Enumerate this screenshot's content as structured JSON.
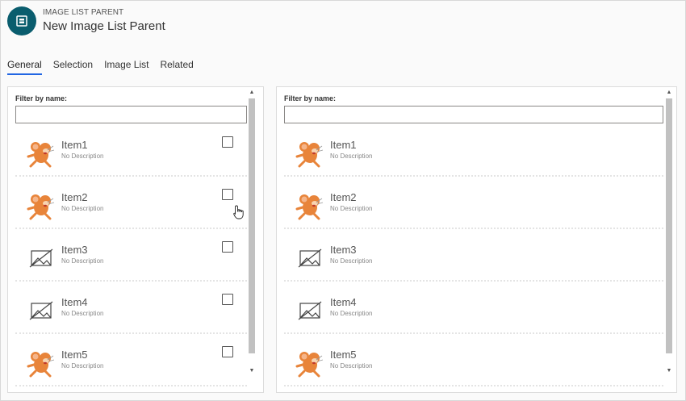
{
  "header": {
    "entity_type": "IMAGE LIST PARENT",
    "record_title": "New Image List Parent",
    "icon": "entity-icon"
  },
  "tabs": [
    {
      "label": "General",
      "active": true
    },
    {
      "label": "Selection",
      "active": false
    },
    {
      "label": "Image List",
      "active": false
    },
    {
      "label": "Related",
      "active": false
    }
  ],
  "left_panel": {
    "filter_label": "Filter by name:",
    "filter_value": "",
    "items": [
      {
        "name": "Item1",
        "description": "No Description",
        "image": "cartoon-mouse",
        "checked": false
      },
      {
        "name": "Item2",
        "description": "No Description",
        "image": "cartoon-mouse",
        "checked": false
      },
      {
        "name": "Item3",
        "description": "No Description",
        "image": "image-placeholder",
        "checked": false
      },
      {
        "name": "Item4",
        "description": "No Description",
        "image": "image-placeholder",
        "checked": false
      },
      {
        "name": "Item5",
        "description": "No Description",
        "image": "cartoon-mouse",
        "checked": false
      }
    ]
  },
  "right_panel": {
    "filter_label": "Filter by name:",
    "filter_value": "",
    "items": [
      {
        "name": "Item1",
        "description": "No Description",
        "image": "cartoon-mouse"
      },
      {
        "name": "Item2",
        "description": "No Description",
        "image": "cartoon-mouse"
      },
      {
        "name": "Item3",
        "description": "No Description",
        "image": "image-placeholder"
      },
      {
        "name": "Item4",
        "description": "No Description",
        "image": "image-placeholder"
      },
      {
        "name": "Item5",
        "description": "No Description",
        "image": "cartoon-mouse"
      }
    ]
  },
  "colors": {
    "accent": "#2266e3",
    "entity_icon_bg": "#0a5d6e"
  }
}
